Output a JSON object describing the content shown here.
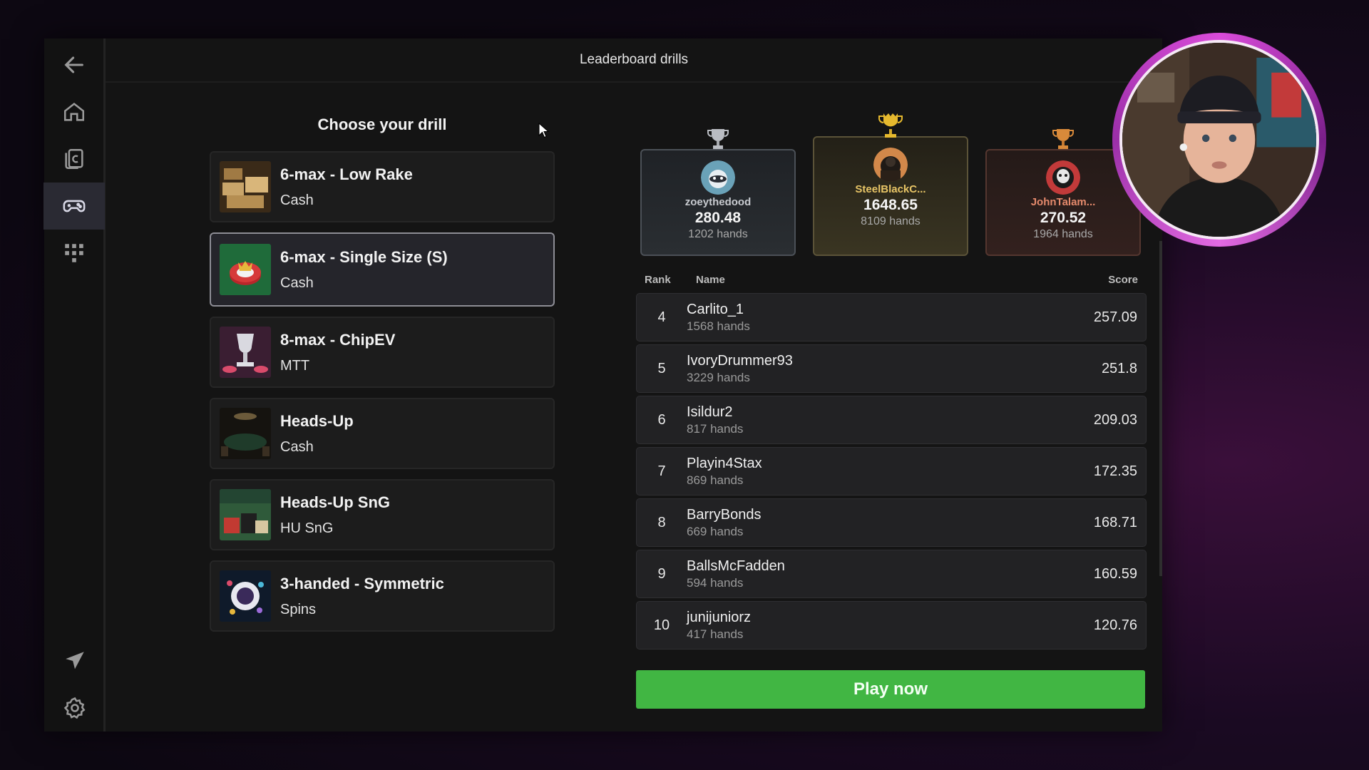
{
  "header": {
    "title": "Leaderboard drills"
  },
  "left": {
    "heading": "Choose your drill",
    "drills": [
      {
        "name": "6-max - Low Rake",
        "type": "Cash"
      },
      {
        "name": "6-max - Single Size (S)",
        "type": "Cash"
      },
      {
        "name": "8-max - ChipEV",
        "type": "MTT"
      },
      {
        "name": "Heads-Up",
        "type": "Cash"
      },
      {
        "name": "Heads-Up SnG",
        "type": "HU SnG"
      },
      {
        "name": "3-handed - Symmetric",
        "type": "Spins"
      }
    ]
  },
  "podium": {
    "second": {
      "name": "zoeythedood",
      "score": "280.48",
      "hands": "1202 hands"
    },
    "first": {
      "name": "SteelBlackC...",
      "score": "1648.65",
      "hands": "8109 hands"
    },
    "third": {
      "name": "JohnTalam...",
      "score": "270.52",
      "hands": "1964 hands"
    }
  },
  "table": {
    "headers": {
      "rank": "Rank",
      "name": "Name",
      "score": "Score"
    },
    "rows": [
      {
        "rank": "4",
        "name": "Carlito_1",
        "hands": "1568 hands",
        "score": "257.09"
      },
      {
        "rank": "5",
        "name": "IvoryDrummer93",
        "hands": "3229 hands",
        "score": "251.8"
      },
      {
        "rank": "6",
        "name": "Isildur2",
        "hands": "817 hands",
        "score": "209.03"
      },
      {
        "rank": "7",
        "name": "Playin4Stax",
        "hands": "869 hands",
        "score": "172.35"
      },
      {
        "rank": "8",
        "name": "BarryBonds",
        "hands": "669 hands",
        "score": "168.71"
      },
      {
        "rank": "9",
        "name": "BallsMcFadden",
        "hands": "594 hands",
        "score": "160.59"
      },
      {
        "rank": "10",
        "name": "junijuniorz",
        "hands": "417 hands",
        "score": "120.76"
      }
    ]
  },
  "actions": {
    "play_label": "Play now"
  },
  "colors": {
    "accent_green": "#41b643",
    "gold": "#e8c566",
    "silver": "#c8cbd0",
    "bronze": "#e58a6c",
    "cam_ring": "#d94bd9"
  },
  "icons": [
    "back-arrow-icon",
    "home-icon",
    "cards-icon",
    "gamepad-icon",
    "grid-icon",
    "send-icon",
    "settings-icon",
    "trophy-icon"
  ]
}
